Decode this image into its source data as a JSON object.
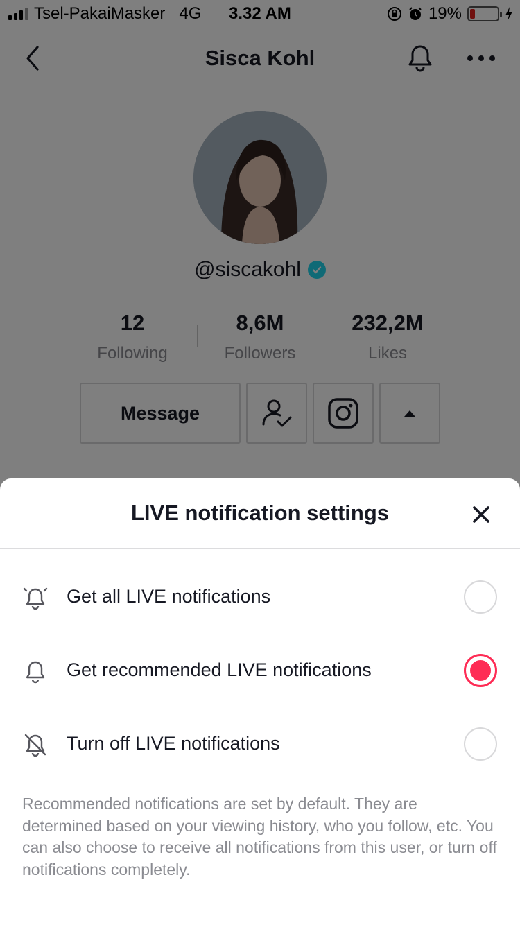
{
  "status_bar": {
    "carrier": "Tsel-PakaiMasker",
    "network": "4G",
    "time": "3.32 AM",
    "battery_percent": "19%",
    "battery_level": 0.19,
    "icons": [
      "signal-icon",
      "rotation-lock-icon",
      "alarm-icon",
      "battery-icon",
      "charging-icon"
    ]
  },
  "nav": {
    "title": "Sisca Kohl",
    "icons": [
      "back-icon",
      "bell-icon",
      "more-icon"
    ]
  },
  "profile": {
    "handle": "@siscakohl",
    "verified": true,
    "stats": [
      {
        "value": "12",
        "label": "Following"
      },
      {
        "value": "8,6M",
        "label": "Followers"
      },
      {
        "value": "232,2M",
        "label": "Likes"
      }
    ],
    "message_label": "Message",
    "action_icons": [
      "following-icon",
      "instagram-icon",
      "caret-up-icon"
    ]
  },
  "sheet": {
    "title": "LIVE notification settings",
    "options": [
      {
        "label": "Get all LIVE notifications",
        "icon": "bell-ringing-icon",
        "selected": false
      },
      {
        "label": "Get recommended LIVE notifications",
        "icon": "bell-icon",
        "selected": true
      },
      {
        "label": "Turn off LIVE notifications",
        "icon": "bell-off-icon",
        "selected": false
      }
    ],
    "note": "Recommended notifications are set by default. They are determined based on your viewing history, who you follow, etc. You can also choose to receive all notifications from this user, or turn off notifications completely."
  },
  "colors": {
    "accent": "#fe2c55",
    "verified": "#20d5ec",
    "secondary_text": "#8a8b91",
    "primary_text": "#161823"
  }
}
